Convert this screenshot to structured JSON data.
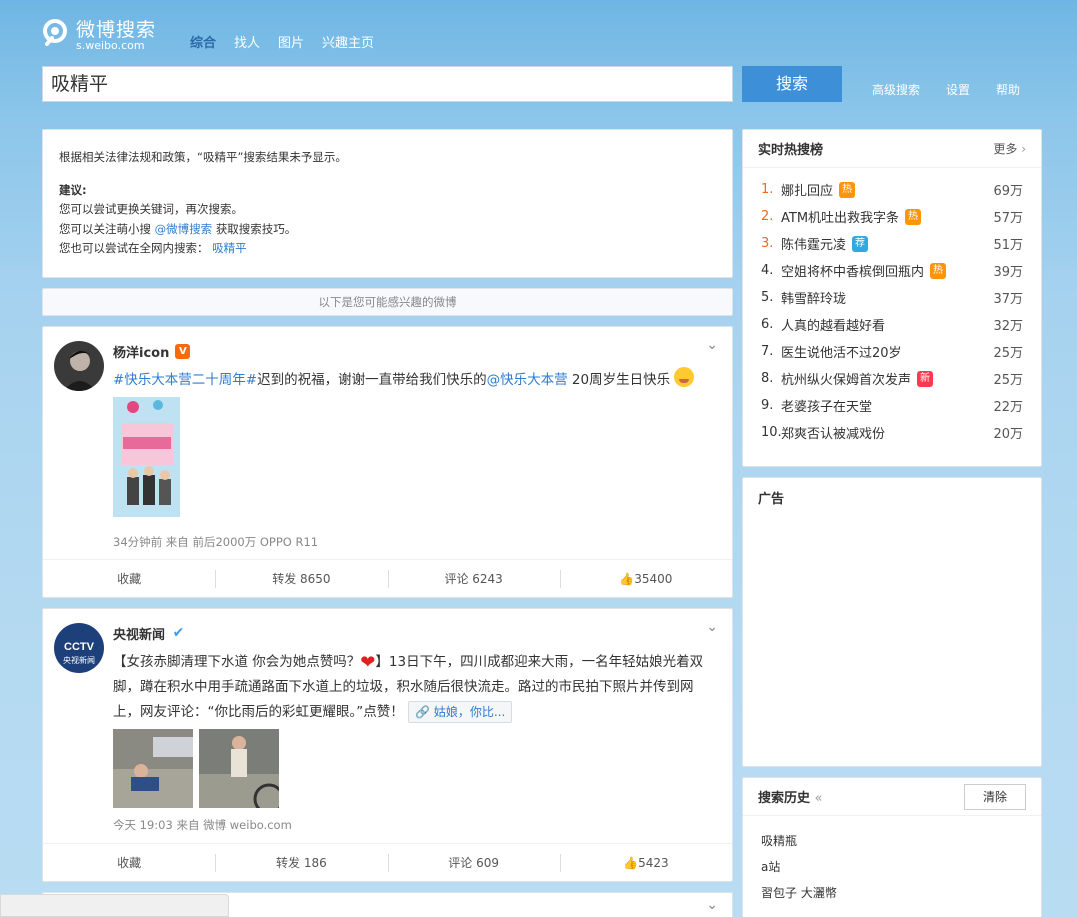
{
  "header": {
    "logo_text": "微博搜索",
    "logo_sub": "s.weibo.com",
    "nav": [
      "综合",
      "找人",
      "图片",
      "兴趣主页"
    ],
    "search_value": "吸精平",
    "search_button": "搜索",
    "links": [
      "高级搜索",
      "设置",
      "帮助"
    ]
  },
  "notice": {
    "line1": "根据相关法律法规和政策，“吸精平”搜索结果未予显示。",
    "suggest_title": "建议:",
    "line2": "您可以尝试更换关键词，再次搜索。",
    "line3_prefix": "您可以关注萌小搜",
    "line3_link": "@微博搜索",
    "line3_suffix": "获取搜索技巧。",
    "line4_prefix": "您也可以尝试在全网内搜索：",
    "line4_link": "吸精平"
  },
  "interest_note": "以下是您可能感兴趣的微博",
  "posts": [
    {
      "author": "杨洋icon",
      "text_tag": "#快乐大本营二十周年#",
      "text_mid": "迟到的祝福，谢谢一直带给我们快乐的",
      "text_mention": "@快乐大本营",
      "text_end": " 20周岁生日快乐",
      "meta": "34分钟前 来自 前后2000万 OPPO R11",
      "actions": [
        "收藏",
        "转发 8650",
        "评论 6243",
        "35400"
      ]
    },
    {
      "author": "央视新闻",
      "text_a": "【女孩赤脚清理下水道 你会为她点赞吗？",
      "text_b": "】13日下午，四川成都迎来大雨，一名年轻姑娘光着双脚，蹲在积水中用手疏通路面下水道上的垃圾，积水随后很快流走。路过的市民拍下照片并传到网上，网友评论：“你比雨后的彩虹更耀眼。”点赞！",
      "link_chip": "姑娘，你比...",
      "meta": "今天 19:03 来自 微博 weibo.com",
      "actions": [
        "收藏",
        "转发 186",
        "评论 609",
        "5423"
      ]
    }
  ],
  "hot": {
    "title": "实时热搜榜",
    "more": "更多",
    "items": [
      {
        "rank": "1.",
        "label": "娜扎回应",
        "tag": "热",
        "num": "69万"
      },
      {
        "rank": "2.",
        "label": "ATM机吐出救我字条",
        "tag": "热",
        "num": "57万"
      },
      {
        "rank": "3.",
        "label": "陈伟霆元凌",
        "tag": "荐",
        "num": "51万"
      },
      {
        "rank": "4.",
        "label": "空姐将杯中香槟倒回瓶内",
        "tag": "热",
        "num": "39万"
      },
      {
        "rank": "5.",
        "label": "韩雪醉玲珑",
        "tag": "",
        "num": "37万"
      },
      {
        "rank": "6.",
        "label": "人真的越看越好看",
        "tag": "",
        "num": "32万"
      },
      {
        "rank": "7.",
        "label": "医生说他活不过20岁",
        "tag": "",
        "num": "25万"
      },
      {
        "rank": "8.",
        "label": "杭州纵火保姆首次发声",
        "tag": "新",
        "num": "25万"
      },
      {
        "rank": "9.",
        "label": "老婆孩子在天堂",
        "tag": "",
        "num": "22万"
      },
      {
        "rank": "10.",
        "label": "郑爽否认被减戏份",
        "tag": "",
        "num": "20万"
      }
    ]
  },
  "ad": {
    "title": "广告"
  },
  "history": {
    "title": "搜索历史",
    "clear": "清除",
    "items": [
      "吸精瓶",
      "a站",
      "習包子 大灑幣"
    ]
  },
  "colors": {
    "accent": "#3d8fd8",
    "link": "#2e7bcf",
    "hot": "#ff9406",
    "new": "#ff3852",
    "rank_top": "#f26b1c"
  }
}
